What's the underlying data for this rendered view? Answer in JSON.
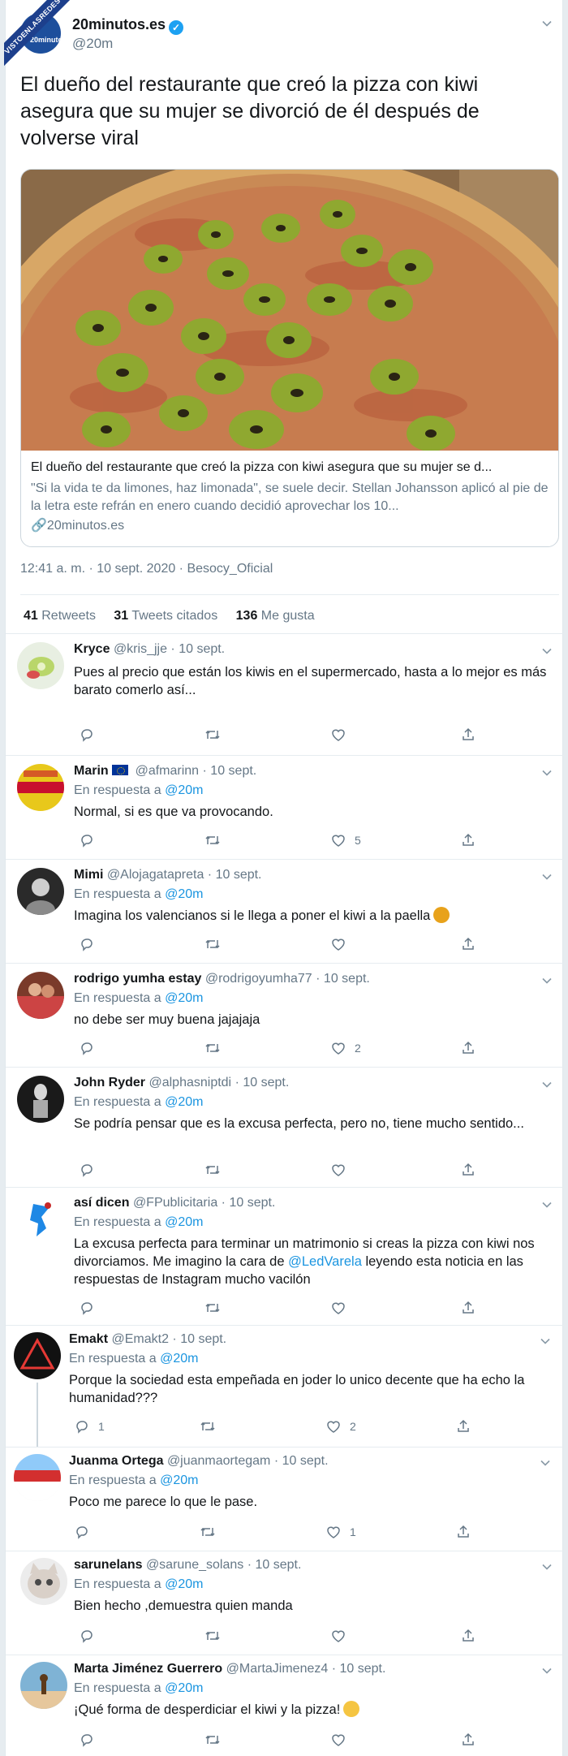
{
  "watermark": "VISTOENLASREDES",
  "main": {
    "avatar_text": "20minutos",
    "name": "20minutos.es",
    "handle": "@20m",
    "text": "El dueño del restaurante que creó la pizza con kiwi asegura que su mujer se divorció de él después de volverse viral",
    "card": {
      "title": "El dueño del restaurante que creó la pizza con kiwi asegura que su mujer se d...",
      "description": "\"Si la vida te da limones, haz limonada\", se suele decir. Stellan Johansson aplicó al pie de la letra este refrán en enero cuando decidió aprovechar los 10...",
      "domain": "20minutos.es"
    },
    "timestamp": "12:41 a. m. · 10 sept. 2020 · Besocy_Oficial",
    "stats": {
      "retweets_count": "41",
      "retweets_label": "Retweets",
      "quotes_count": "31",
      "quotes_label": "Tweets citados",
      "likes_count": "136",
      "likes_label": "Me gusta"
    }
  },
  "replies": [
    {
      "name": "Kryce",
      "handle": "@kris_jje",
      "date": "· 10 sept.",
      "reply_to": "",
      "mention": "",
      "text": "Pues al precio que están los kiwis en el supermercado, hasta a lo mejor es más barato comerlo así...",
      "reply_count": "",
      "like_count": ""
    },
    {
      "name": "Marin",
      "handle": "@afmarinn",
      "date": "· 10 sept.",
      "reply_to": "En respuesta a",
      "mention": "@20m",
      "text": "Normal, si es que va provocando.",
      "reply_count": "",
      "like_count": "5"
    },
    {
      "name": "Mimi",
      "handle": "@Alojagatapreta",
      "date": "· 10 sept.",
      "reply_to": "En respuesta a",
      "mention": "@20m",
      "text": "Imagina los valencianos si le llega a poner el kiwi a la paella",
      "reply_count": "",
      "like_count": ""
    },
    {
      "name": "rodrigo yumha estay",
      "handle": "@rodrigoyumha77",
      "date": "· 10 sept.",
      "reply_to": "En respuesta a",
      "mention": "@20m",
      "text": "no debe ser muy buena jajajaja",
      "reply_count": "",
      "like_count": "2"
    },
    {
      "name": "John Ryder",
      "handle": "@alphasniptdi",
      "date": "· 10 sept.",
      "reply_to": "En respuesta a",
      "mention": "@20m",
      "text": "Se podría pensar que es la excusa perfecta, pero no, tiene mucho sentido...",
      "reply_count": "",
      "like_count": ""
    },
    {
      "name": "así dicen",
      "handle": "@FPublicitaria",
      "date": "· 10 sept.",
      "reply_to": "En respuesta a",
      "mention": "@20m",
      "text_before": "La excusa perfecta para terminar un matrimonio si creas la pizza con kiwi nos divorciamos. Me imagino la cara de ",
      "text_mention": "@LedVarela",
      "text_after": "  leyendo esta noticia en las respuestas de Instagram mucho vacilón",
      "reply_count": "",
      "like_count": ""
    },
    {
      "name": "Emakt",
      "handle": "@Emakt2",
      "date": "· 10 sept.",
      "reply_to": "En respuesta a",
      "mention": "@20m",
      "text": "Porque la sociedad esta empeñada en joder lo unico decente que ha echo la humanidad???",
      "reply_count": "1",
      "like_count": "2"
    },
    {
      "name": "Juanma Ortega",
      "handle": "@juanmaortegam",
      "date": "· 10 sept.",
      "reply_to": "En respuesta a",
      "mention": "@20m",
      "text": "Poco me parece lo que le pase.",
      "reply_count": "",
      "like_count": "1"
    },
    {
      "name": "sarunelans",
      "handle": "@sarune_solans",
      "date": "· 10 sept.",
      "reply_to": "En respuesta a",
      "mention": "@20m",
      "text": "Bien hecho ,demuestra quien manda",
      "reply_count": "",
      "like_count": ""
    },
    {
      "name": "Marta Jiménez Guerrero",
      "handle": "@MartaJimenez4",
      "date": "· 10 sept.",
      "reply_to": "En respuesta a",
      "mention": "@20m",
      "text": "¡Qué forma de desperdiciar el kiwi y la pizza!",
      "reply_count": "",
      "like_count": ""
    }
  ],
  "colors": {
    "link": "#1b95e0",
    "verified": "#1da1f2",
    "muted": "#657786"
  }
}
